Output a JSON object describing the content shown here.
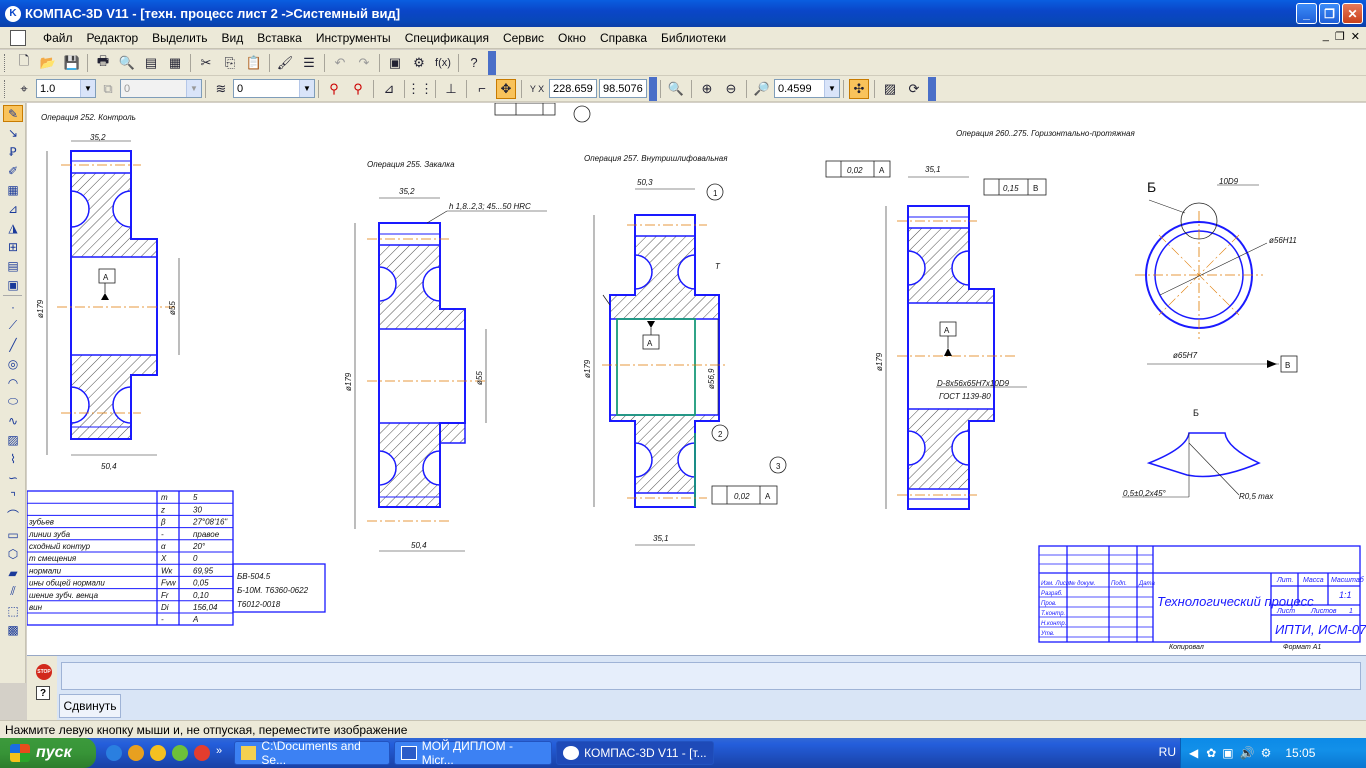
{
  "window": {
    "title": "КОМПАС-3D V11 - [техн. процесс лист 2 ->Системный вид]"
  },
  "menu": [
    "Файл",
    "Редактор",
    "Выделить",
    "Вид",
    "Вставка",
    "Инструменты",
    "Спецификация",
    "Сервис",
    "Окно",
    "Справка",
    "Библиотеки"
  ],
  "toolbar": {
    "scale_value": "1.0",
    "layer_value": "0",
    "style_value": "0",
    "coord_x": "228.659",
    "coord_y": "98.5076",
    "zoom_value": "0.4599"
  },
  "drawing": {
    "op252": "Операция 252. Контроль",
    "op255": "Операция 255. Закалка",
    "op257": "Операция 257. Внутришлифовальная",
    "op260": "Операция 260..275. Горизонтально-протяжная",
    "hardness": "h 1,8..2,3;  45...50  HRC",
    "dim_352": "35,2",
    "dim_504": "50,4",
    "dim_179": "ø179",
    "dim_55": "ø55",
    "dim_503": "50,3",
    "dim_351": "35,1",
    "dim_569": "ø56,9",
    "dim_002": "0,02",
    "dim_015": "0,15",
    "spline": "D-8x56x65H7x10D9",
    "gost": "ГОСТ 1139-80",
    "dim_56h11": "ø56H11",
    "dim_65h7": "ø65H7",
    "dim_10d9": "10D9",
    "chamfer": "0,5±0,2x45°",
    "radius": "R0,5 max",
    "letter_b": "Б",
    "letter_a": "А",
    "letter_v": "В",
    "letter_t": "Т",
    "n1": "1",
    "n2": "2",
    "n3": "3"
  },
  "params_table": {
    "rows": [
      [
        "",
        "m",
        "5"
      ],
      [
        "",
        "z",
        "30"
      ],
      [
        "зубьев",
        "β",
        "27°08'16\""
      ],
      [
        "линии зуба",
        "-",
        "правое"
      ],
      [
        "сходный контур",
        "α",
        "20°"
      ],
      [
        "т смещения",
        "X",
        "0"
      ],
      [
        "нормали",
        "Wк",
        "69,95"
      ],
      [
        "ины общей нормали",
        "Fvw",
        "0,05"
      ],
      [
        "шение зубч. венца",
        "Fr",
        "0,10"
      ],
      [
        "вин",
        "Di",
        "156,04"
      ],
      [
        "",
        "-",
        "А"
      ]
    ],
    "extra": [
      "БВ-504.5",
      "Б-10М. Т6360-0622",
      "Т6012-0018"
    ]
  },
  "title_block": {
    "title": "Технологический процесс",
    "org": "ИПТИ, ИСМ-07",
    "lit": "Лит.",
    "mass": "Масса",
    "scale": "Масштаб",
    "sheet": "Лист",
    "sheets": "Листов",
    "sheets_val": "1",
    "scale_val": "1:1",
    "copied": "Копировал",
    "format": "Формат   А1",
    "rows": [
      "Изм. Лист",
      "Разраб.",
      "Пров.",
      "Т.контр.",
      "Н.контр.",
      "Утв."
    ],
    "header_cells": [
      "№ докум.",
      "Подп.",
      "Дата"
    ]
  },
  "panel": {
    "tab_label": "Сдвинуть"
  },
  "status": {
    "hint": "Нажмите левую кнопку мыши и, не отпуская, переместите изображение"
  },
  "taskbar": {
    "start": "пуск",
    "tasks": [
      "C:\\Documents and Se...",
      "МОЙ ДИПЛОМ - Micr...",
      "КОМПАС-3D V11 - [т..."
    ],
    "lang": "RU",
    "time": "15:05"
  },
  "colors": {
    "outline": "#1a1aff",
    "centerline": "#e07a00",
    "frame": "#1a1aff"
  }
}
